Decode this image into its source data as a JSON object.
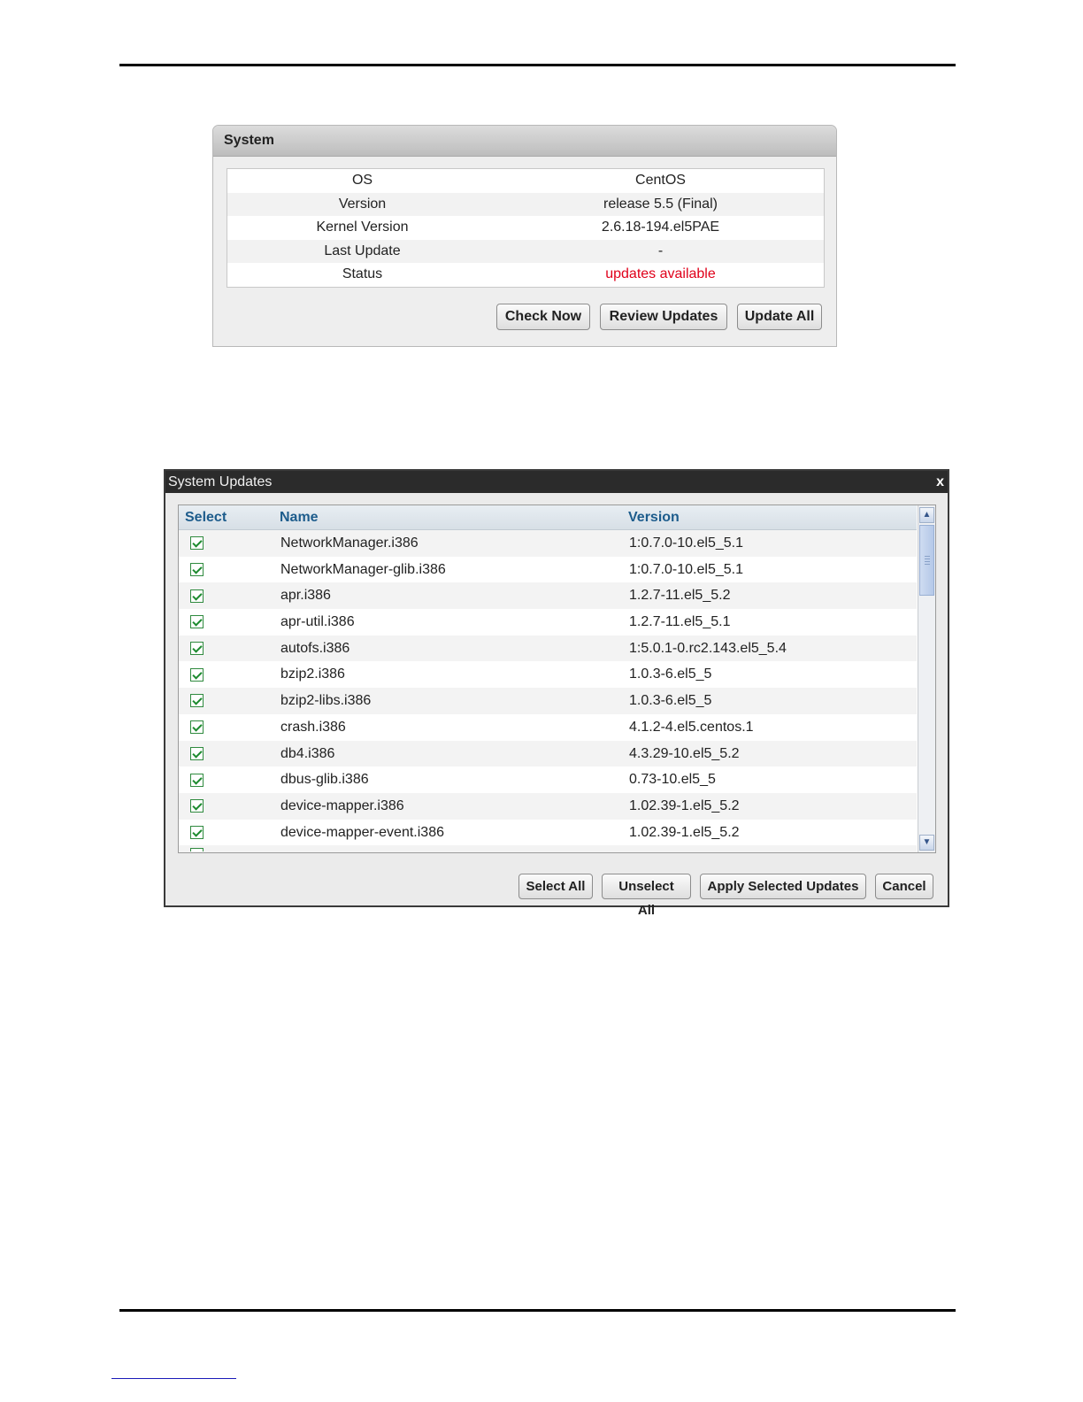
{
  "system_panel": {
    "title": "System",
    "rows": [
      {
        "label": "OS",
        "value": "CentOS"
      },
      {
        "label": "Version",
        "value": "release 5.5 (Final)"
      },
      {
        "label": "Kernel Version",
        "value": "2.6.18-194.el5PAE"
      },
      {
        "label": "Last Update",
        "value": "-"
      },
      {
        "label": "Status",
        "value": "updates available"
      }
    ],
    "status_color": "#e0001a",
    "buttons": {
      "check_now": "Check Now",
      "review_updates": "Review Updates",
      "update_all": "Update All"
    }
  },
  "updates_dialog": {
    "title": "System Updates",
    "close_glyph": "x",
    "columns": {
      "select": "Select",
      "name": "Name",
      "version": "Version"
    },
    "rows": [
      {
        "name": "NetworkManager.i386",
        "version": "1:0.7.0-10.el5_5.1",
        "checked": true
      },
      {
        "name": "NetworkManager-glib.i386",
        "version": "1:0.7.0-10.el5_5.1",
        "checked": true
      },
      {
        "name": "apr.i386",
        "version": "1.2.7-11.el5_5.2",
        "checked": true
      },
      {
        "name": "apr-util.i386",
        "version": "1.2.7-11.el5_5.1",
        "checked": true
      },
      {
        "name": "autofs.i386",
        "version": "1:5.0.1-0.rc2.143.el5_5.4",
        "checked": true
      },
      {
        "name": "bzip2.i386",
        "version": "1.0.3-6.el5_5",
        "checked": true
      },
      {
        "name": "bzip2-libs.i386",
        "version": "1.0.3-6.el5_5",
        "checked": true
      },
      {
        "name": "crash.i386",
        "version": "4.1.2-4.el5.centos.1",
        "checked": true
      },
      {
        "name": "db4.i386",
        "version": "4.3.29-10.el5_5.2",
        "checked": true
      },
      {
        "name": "dbus-glib.i386",
        "version": "0.73-10.el5_5",
        "checked": true
      },
      {
        "name": "device-mapper.i386",
        "version": "1.02.39-1.el5_5.2",
        "checked": true
      },
      {
        "name": "device-mapper-event.i386",
        "version": "1.02.39-1.el5_5.2",
        "checked": true
      }
    ],
    "buttons": {
      "select_all": "Select All",
      "unselect_all": "Unselect All",
      "apply": "Apply Selected Updates",
      "cancel": "Cancel"
    },
    "icons": {
      "up": "scroll-up-arrow-icon",
      "down": "scroll-down-arrow-icon"
    }
  }
}
